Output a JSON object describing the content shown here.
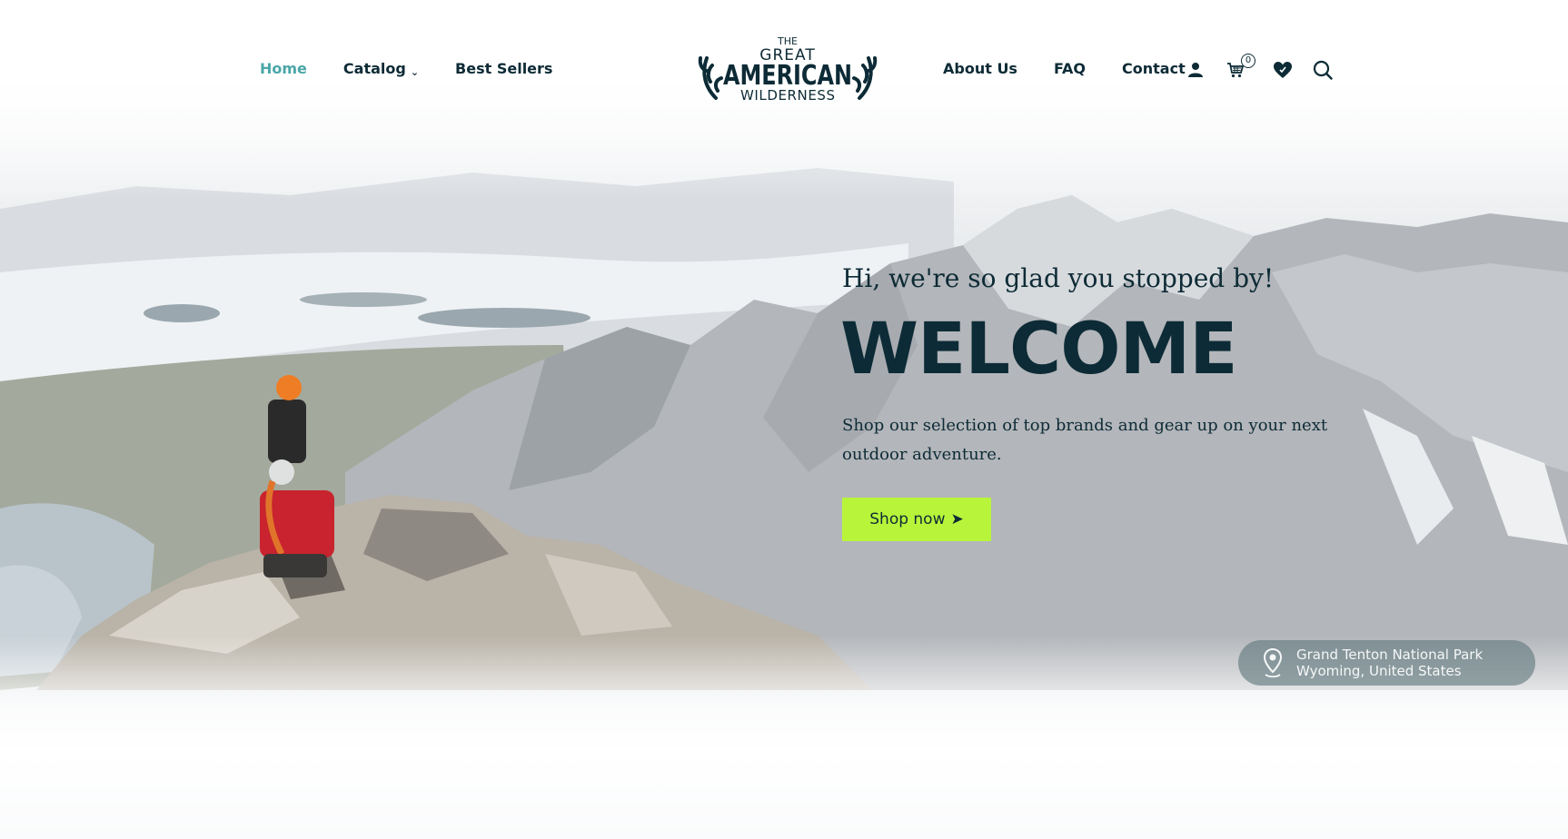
{
  "nav": {
    "left": [
      {
        "label": "Home",
        "active": true
      },
      {
        "label": "Catalog",
        "dropdown": true
      },
      {
        "label": "Best Sellers"
      }
    ],
    "right": [
      {
        "label": "About Us"
      },
      {
        "label": "FAQ"
      },
      {
        "label": "Contact"
      }
    ]
  },
  "logo": {
    "line1": "THE",
    "line2": "GREAT",
    "line3": "AMERICAN",
    "line4": "WILDERNESS"
  },
  "icons": {
    "account": "user-icon",
    "cart": "cart-icon",
    "cart_count": "0",
    "wishlist": "heart-icon",
    "search": "search-icon"
  },
  "hero": {
    "greeting": "Hi, we're so glad you stopped by!",
    "title": "WELCOME",
    "tagline": "Shop our selection of top brands and gear up on your next outdoor adventure.",
    "cta_label": "Shop now",
    "cta_icon": "➤"
  },
  "location": {
    "icon": "map-pin-icon",
    "line1": "Grand Tenton National Park",
    "line2": "Wyoming, United States"
  },
  "colors": {
    "brand_dark": "#0d2b36",
    "accent_teal": "#4aa6a8",
    "cta_green": "#b8f53a"
  }
}
